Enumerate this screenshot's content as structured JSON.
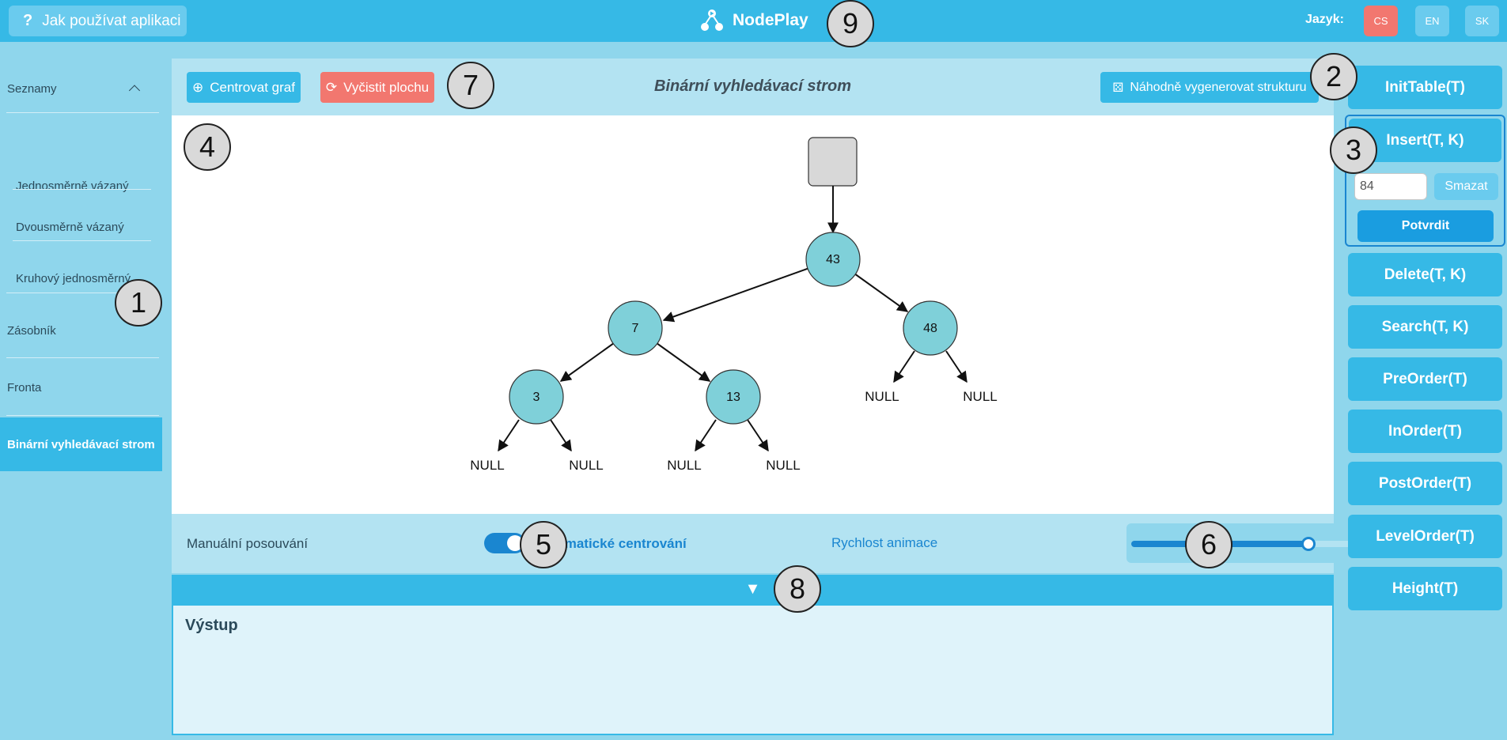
{
  "topbar": {
    "help_label": "Jak používat aplikaci",
    "app_name": "NodePlay",
    "language_label": "Jazyk:",
    "languages": [
      "CS",
      "EN",
      "SK"
    ],
    "active_language": "CS"
  },
  "sidebar": {
    "group_label": "Seznamy",
    "items": [
      {
        "label": "Jednosměrně vázaný"
      },
      {
        "label": "Dvousměrně vázaný"
      },
      {
        "label": "Kruhový jednosměrný"
      },
      {
        "label": "Zásobník"
      },
      {
        "label": "Fronta"
      },
      {
        "label": "Binární vyhledávací strom"
      }
    ]
  },
  "toolbar": {
    "center_label": "Centrovat graf",
    "clear_label": "Vyčistit plochu",
    "title": "Binární vyhledávací strom",
    "random_label": "Náhodně vygenerovat strukturu"
  },
  "tree": {
    "nodes": [
      "43",
      "7",
      "48",
      "3",
      "13"
    ],
    "null_label": "NULL"
  },
  "controls": {
    "manual_label": "Manuální posouvání",
    "auto_label": "Automatické centrování",
    "speed_label": "Rychlost animace",
    "speed_fraction": 0.5
  },
  "output": {
    "title": "Výstup",
    "toggle_glyph": "▼"
  },
  "operations": {
    "init": "InitTable(T)",
    "insert": "Insert(T, K)",
    "insert_value": "84",
    "delete_input_label": "Smazat",
    "confirm_label": "Potvrdit",
    "others": [
      "Delete(T, K)",
      "Search(T, K)",
      "PreOrder(T)",
      "InOrder(T)",
      "PostOrder(T)",
      "LevelOrder(T)",
      "Height(T)"
    ]
  },
  "markers": [
    "1",
    "2",
    "3",
    "4",
    "5",
    "6",
    "7",
    "8",
    "9"
  ],
  "colors": {
    "topbar": "#36b9e6",
    "accent_red": "#f2776f",
    "node_fill": "#7fd0d9",
    "toggle_blue": "#1a86d0"
  }
}
